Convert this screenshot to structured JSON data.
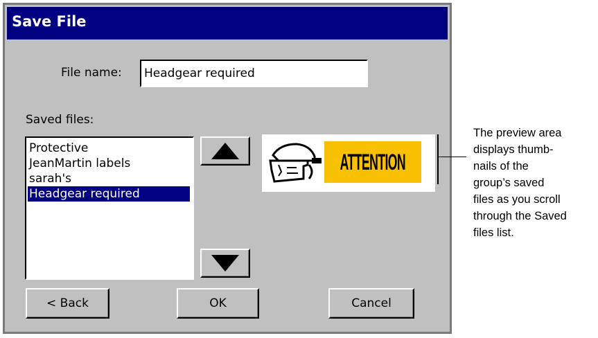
{
  "dialog": {
    "title": "Save File",
    "file_name_label": "File name:",
    "file_name_value": "Headgear required",
    "saved_files_label": "Saved files:",
    "saved_files": [
      "Protective",
      "JeanMartin labels",
      "sarah's",
      "Headgear required"
    ],
    "selected_index": 3,
    "buttons": {
      "back": "< Back",
      "ok": "OK",
      "cancel": "Cancel"
    },
    "preview_text": "ATTENTION"
  },
  "callout": [
    "The preview area",
    "displays thumb-",
    "nails of the",
    "group’s saved",
    "files as you scroll",
    "through the Saved",
    "files list."
  ],
  "colors": {
    "titlebar": "#000080",
    "dialog_bg": "#c0c0c0",
    "selection": "#000080",
    "attention_bg": "#f8c000"
  },
  "icons": {
    "scroll_up": "arrow-up-icon",
    "scroll_down": "arrow-down-icon",
    "preview_figure": "face-shield-icon"
  }
}
